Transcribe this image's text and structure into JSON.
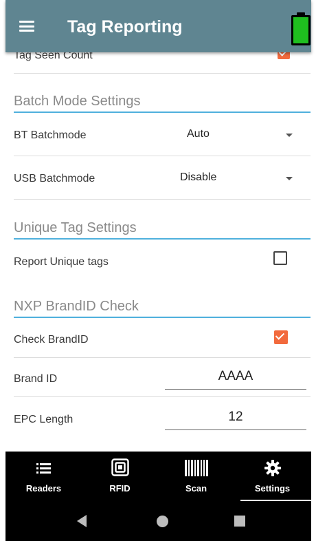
{
  "app_bar": {
    "title": "Tag Reporting",
    "menu_icon": "hamburger-menu-icon",
    "battery_icon": "battery-full-icon",
    "battery_color": "#1fbf1f"
  },
  "top_row": {
    "label": "Tag Seen Count",
    "checked": true
  },
  "batch_mode": {
    "title": "Batch Mode Settings",
    "bt": {
      "label": "BT Batchmode",
      "value": "Auto"
    },
    "usb": {
      "label": "USB Batchmode",
      "value": "Disable"
    }
  },
  "unique_tag": {
    "title": "Unique Tag Settings",
    "report": {
      "label": "Report Unique tags",
      "checked": false
    }
  },
  "nxp_brandid": {
    "title": "NXP BrandID Check",
    "check": {
      "label": "Check BrandID",
      "checked": true
    },
    "brand_id": {
      "label": "Brand ID",
      "value": "AAAA"
    },
    "epc_length": {
      "label": "EPC Length",
      "value": "12"
    }
  },
  "bottom_nav": {
    "items": [
      {
        "label": "Readers",
        "icon": "list-icon"
      },
      {
        "label": "RFID",
        "icon": "rfid-tag-icon"
      },
      {
        "label": "Scan",
        "icon": "barcode-icon"
      },
      {
        "label": "Settings",
        "icon": "gear-icon"
      }
    ],
    "active": "Settings"
  },
  "system_nav": {
    "back_icon": "back-triangle-icon",
    "home_icon": "home-circle-icon",
    "recent_icon": "recent-square-icon"
  },
  "colors": {
    "app_bar": "#5f8591",
    "accent_line": "#4fb0dd",
    "checkbox_checked": "#f26a3d"
  }
}
